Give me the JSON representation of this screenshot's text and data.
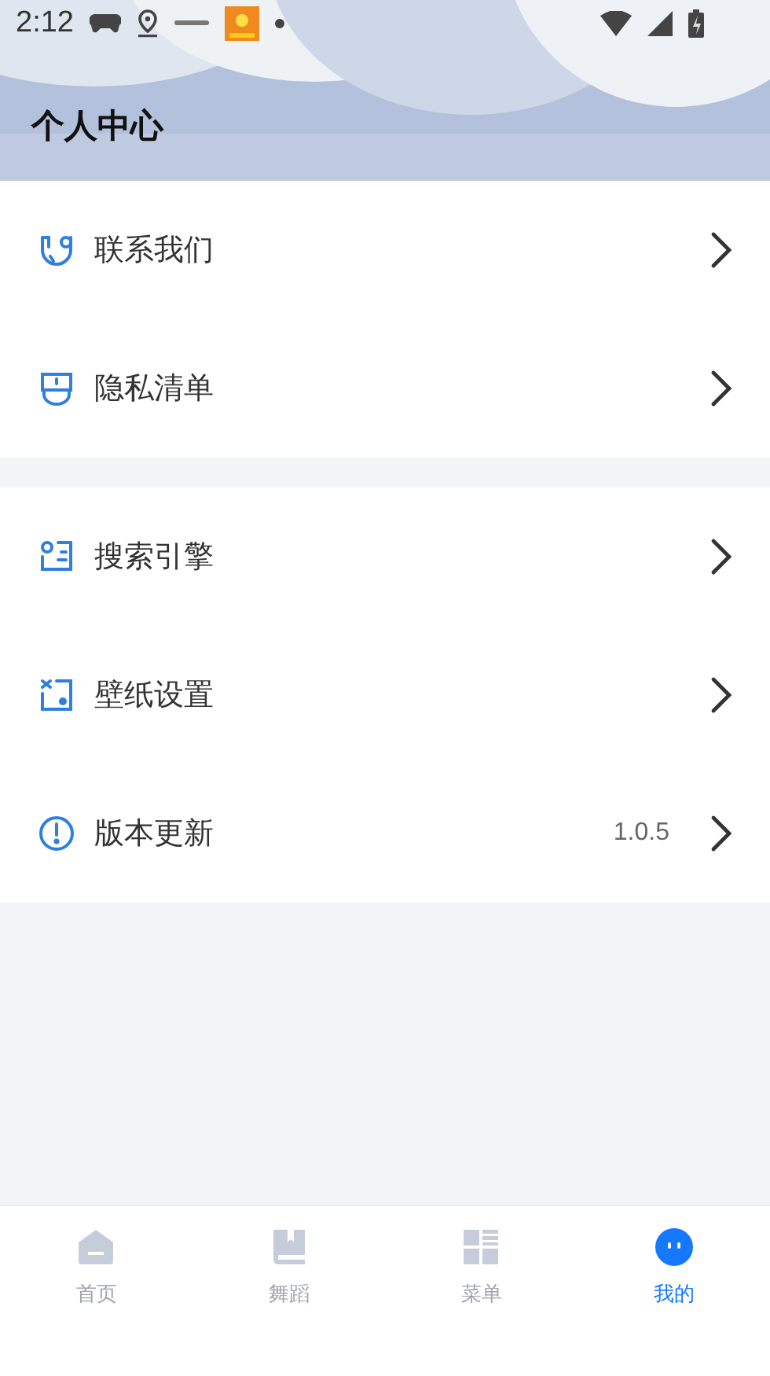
{
  "status_bar": {
    "time": "2:12"
  },
  "header": {
    "title": "个人中心"
  },
  "groups": [
    {
      "items": [
        {
          "kind": "contact",
          "label": "联系我们"
        },
        {
          "kind": "privacy",
          "label": "隐私清单"
        }
      ]
    },
    {
      "items": [
        {
          "kind": "search",
          "label": "搜索引擎"
        },
        {
          "kind": "wallpaper",
          "label": "壁纸设置"
        },
        {
          "kind": "update",
          "label": "版本更新",
          "value": "1.0.5"
        }
      ]
    }
  ],
  "tab_bar": [
    {
      "kind": "home",
      "label": "首页",
      "selected": false
    },
    {
      "kind": "book",
      "label": "舞蹈",
      "selected": false
    },
    {
      "kind": "grid",
      "label": "菜单",
      "selected": false
    },
    {
      "kind": "face",
      "label": "我的",
      "selected": true
    }
  ]
}
